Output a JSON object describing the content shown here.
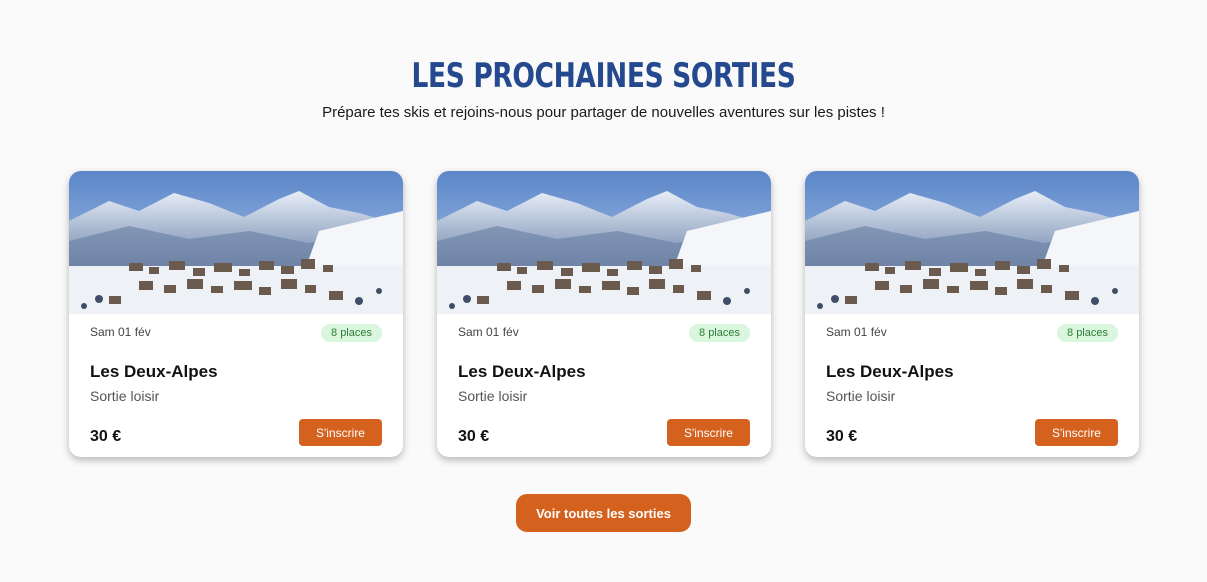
{
  "header": {
    "title": "LES PROCHAINES SORTIES",
    "subtitle": "Prépare tes skis et rejoins-nous pour partager de nouvelles aventures sur les pistes !"
  },
  "cards": [
    {
      "date": "Sam 01 fév",
      "places": "8 places",
      "title": "Les Deux-Alpes",
      "type": "Sortie loisir",
      "price": "30 €",
      "button": "S'inscrire"
    },
    {
      "date": "Sam 01 fév",
      "places": "8 places",
      "title": "Les Deux-Alpes",
      "type": "Sortie loisir",
      "price": "30 €",
      "button": "S'inscrire"
    },
    {
      "date": "Sam 01 fév",
      "places": "8 places",
      "title": "Les Deux-Alpes",
      "type": "Sortie loisir",
      "price": "30 €",
      "button": "S'inscrire"
    }
  ],
  "footer": {
    "see_all_label": "Voir toutes les sorties"
  },
  "colors": {
    "title_blue": "#24498e",
    "accent_orange": "#d5611f",
    "badge_green_bg": "#d9f7dc",
    "badge_green_text": "#2f7d3a"
  },
  "icons": {
    "card_image": "snowy-mountain-village-photo"
  }
}
